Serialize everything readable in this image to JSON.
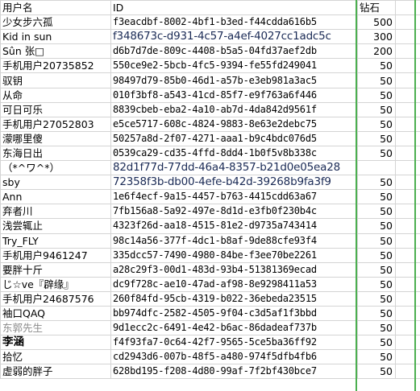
{
  "header": {
    "name": "用户名",
    "id": "ID",
    "diamonds": "钻石"
  },
  "rows": [
    {
      "name": "少女步六孤",
      "id": "f3eacdbf-8002-4bf1-b3ed-f44cdda616b5",
      "diamonds": "500",
      "style": ""
    },
    {
      "name": "Kid in sun",
      "id": "f348673c-d931-4c57-a4ef-4027cc1adc5c",
      "diamonds": "300",
      "style": "big"
    },
    {
      "name": "Sûn 张□",
      "id": "d6b7d7de-809c-4408-b5a5-04fd37aef2db",
      "diamonds": "200",
      "style": ""
    },
    {
      "name": "手机用户20735852",
      "id": "550ce9e2-5bcb-4fc5-9394-fe55fd249041",
      "diamonds": "50",
      "style": ""
    },
    {
      "name": "驭钥",
      "id": "98497d79-85b0-46d1-a57b-e3eb981a3ac5",
      "diamonds": "50",
      "style": ""
    },
    {
      "name": "从命",
      "id": "010f3bf8-a543-41cd-85f7-e9f763a6f446",
      "diamonds": "50",
      "style": ""
    },
    {
      "name": "可日可乐",
      "id": "8839cbeb-eba2-4a10-ab7d-4da842d9561f",
      "diamonds": "50",
      "style": ""
    },
    {
      "name": "手机用户27052803",
      "id": "e5ce5717-608c-4824-9883-8e63e2debc75",
      "diamonds": "50",
      "style": ""
    },
    {
      "name": "濛哪里傻",
      "id": "50257a8d-2f07-4271-aaa1-b9c4bdc076d5",
      "diamonds": "50",
      "style": ""
    },
    {
      "name": "东海日出",
      "id": "0539ca29-cd35-4ffd-8dd4-1b0f5v8b338c",
      "diamonds": "50",
      "style": ""
    },
    {
      "name": "（*^ワ^*）",
      "id": "82d1f77d-77dd-46a4-8357-b21d0e05ea28",
      "diamonds": "",
      "style": "big"
    },
    {
      "name": "sby",
      "id": "72358f3b-db00-4efe-b42d-39268b9fa3f9",
      "diamonds": "50",
      "style": "big"
    },
    {
      "name": "Ann",
      "id": "1e6f4ecf-9a15-4457-b763-4415cdd63a67",
      "diamonds": "50",
      "style": ""
    },
    {
      "name": "弃者川",
      "id": "7fb156a8-5a92-497e-8d1d-e3fb0f230b4c",
      "diamonds": "50",
      "style": ""
    },
    {
      "name": "浅尝辄止",
      "id": "4323f26d-aa18-4515-81e2-d9735a743414",
      "diamonds": "50",
      "style": ""
    },
    {
      "name": "Try_FLY",
      "id": "98c14a56-377f-4dc1-b8af-9de88cfe93f4",
      "diamonds": "50",
      "style": ""
    },
    {
      "name": "手机用户9461247",
      "id": "335dcc57-7490-4980-84be-f3ee70be2261",
      "diamonds": "50",
      "style": ""
    },
    {
      "name": "要胖十斤",
      "id": "a28c29f3-00d1-483d-93b4-51381369ecad",
      "diamonds": "50",
      "style": ""
    },
    {
      "name": "じ☆ve『辟缘』",
      "id": "dc9f728c-ae10-47ad-af98-8e9298411a53",
      "diamonds": "50",
      "style": ""
    },
    {
      "name": "手机用户24687576",
      "id": "260f84fd-95cb-4319-b022-36ebeda23515",
      "diamonds": "50",
      "style": ""
    },
    {
      "name": "袖口QAQ",
      "id": "bb974dfc-2582-4505-9f04-c3d5af1f3bbd",
      "diamonds": "50",
      "style": ""
    },
    {
      "name": "东郭先生",
      "id": "9d1ecc2c-6491-4e42-b6ac-86dadeaf737b",
      "diamonds": "50",
      "style": "grey"
    },
    {
      "name": "李涵",
      "id": "f4f93fa7-0c64-42f7-9565-5ce5ba36ff92",
      "diamonds": "50",
      "style": "bold"
    },
    {
      "name": "拾忆",
      "id": "cd2943d6-007b-48f5-a480-974f5dfb4fb6",
      "diamonds": "50",
      "style": ""
    },
    {
      "name": "虚弱的胖子",
      "id": "628bd195-f208-4d80-99af-7f2bf430bce7",
      "diamonds": "50",
      "style": ""
    }
  ]
}
